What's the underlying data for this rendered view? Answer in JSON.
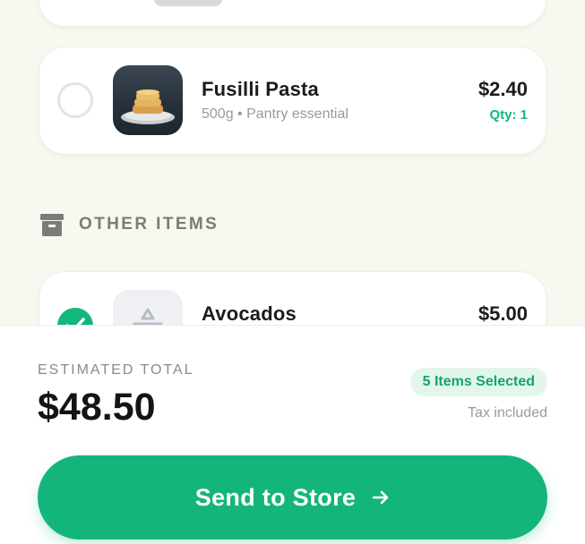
{
  "items": [
    {
      "name": "Fusilli Pasta",
      "subtitle": "500g • Pantry essential",
      "price": "$2.40",
      "qty": "Qty: 1",
      "selected": false,
      "image": "pasta-photo"
    },
    {
      "name": "Avocados",
      "price": "$5.00",
      "selected": true,
      "image": "scale-placeholder-icon"
    }
  ],
  "section": {
    "title": "OTHER ITEMS",
    "icon": "archive-box-icon"
  },
  "footer": {
    "estimated_label": "ESTIMATED TOTAL",
    "estimated_value": "$48.50",
    "selected_badge": "5 Items Selected",
    "tax_note": "Tax included",
    "cta_label": "Send to Store",
    "cta_icon": "arrow-right-icon"
  },
  "colors": {
    "accent": "#13b87b",
    "background": "#f8f8f1",
    "badge_bg": "#e3f6ec"
  }
}
